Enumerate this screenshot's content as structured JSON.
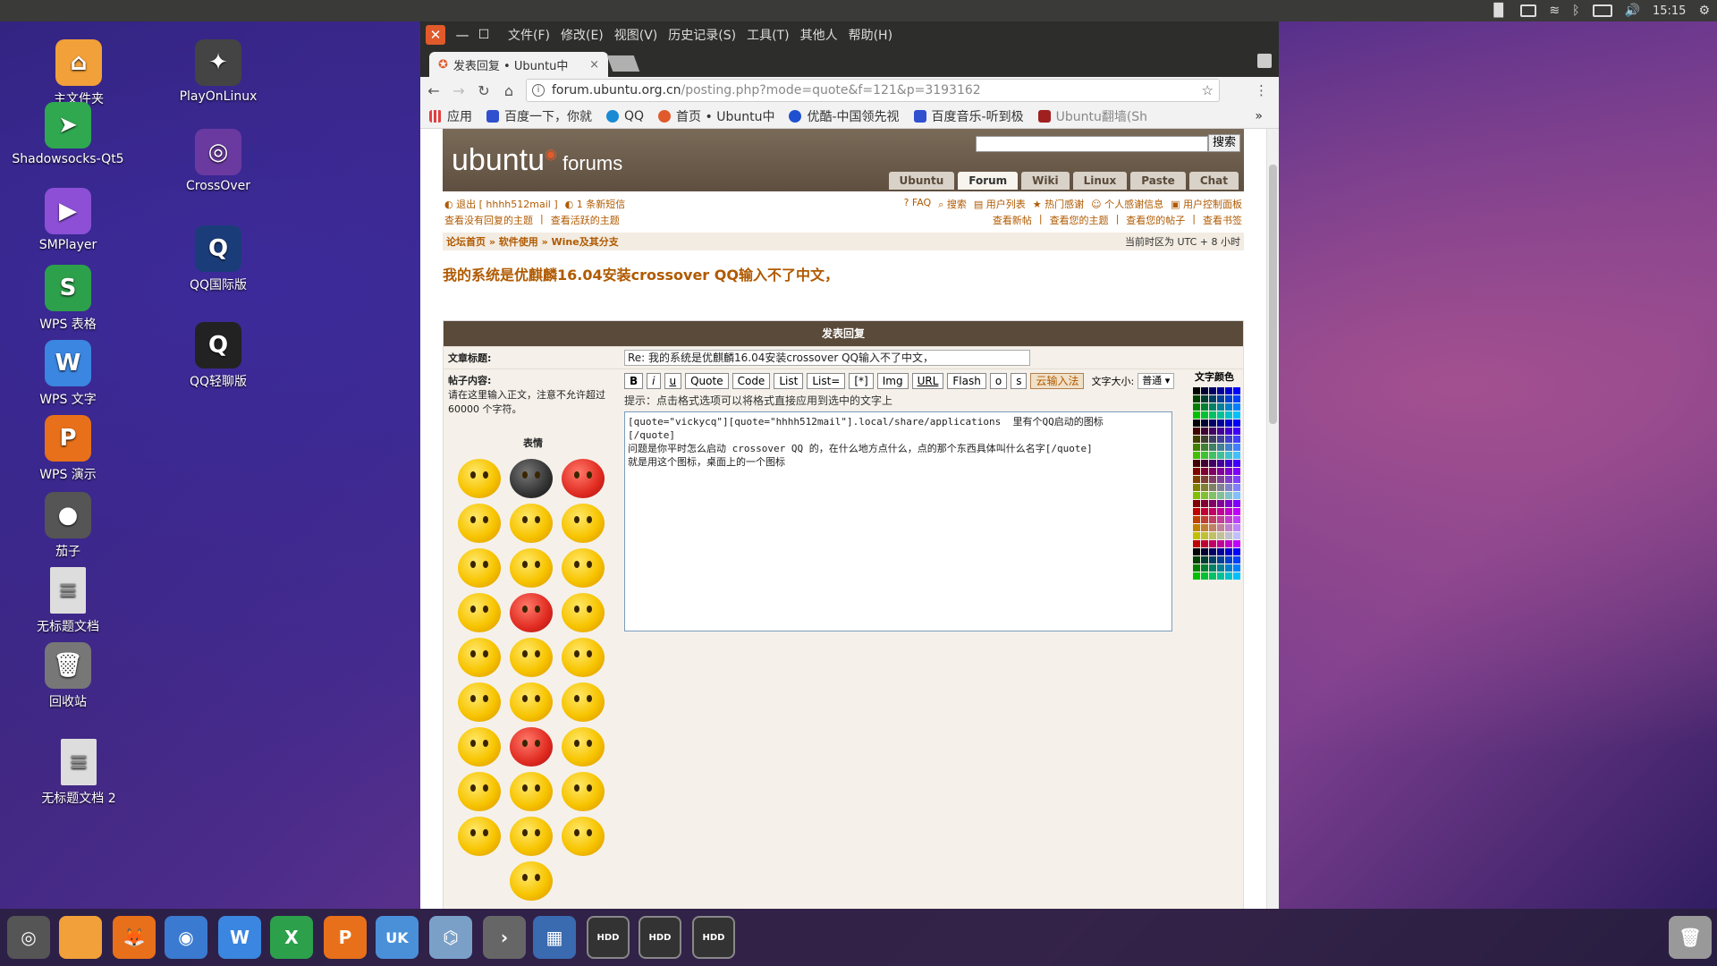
{
  "clock": "15:15",
  "desktop": {
    "icons": [
      {
        "label": "主文件夹",
        "color": "#f2a03a",
        "glyph": "⌂"
      },
      {
        "label": "Shadowsocks-Qt5",
        "color": "#2fa84f",
        "glyph": "➤"
      },
      {
        "label": "SMPlayer",
        "color": "#8c4fd6",
        "glyph": "▶"
      },
      {
        "label": "WPS 表格",
        "color": "#2ca04a",
        "glyph": "S"
      },
      {
        "label": "WPS 文字",
        "color": "#3a86e0",
        "glyph": "W"
      },
      {
        "label": "WPS 演示",
        "color": "#e8701a",
        "glyph": "P"
      },
      {
        "label": "茄子",
        "color": "#555555",
        "glyph": "●"
      },
      {
        "label": "无标题文档",
        "color": "#dddddd",
        "glyph": "≡"
      },
      {
        "label": "回收站",
        "color": "#777777",
        "glyph": "🗑"
      },
      {
        "label": "无标题文档 2",
        "color": "#dddddd",
        "glyph": "≡"
      },
      {
        "label": "PlayOnLinux",
        "color": "#444444",
        "glyph": "✦"
      },
      {
        "label": "CrossOver",
        "color": "#6a3aa0",
        "glyph": "◎"
      },
      {
        "label": "QQ国际版",
        "color": "#1a3d7a",
        "glyph": "Q"
      },
      {
        "label": "QQ轻聊版",
        "color": "#222222",
        "glyph": "Q"
      }
    ]
  },
  "browser": {
    "window_controls": {
      "close": "✕",
      "minimize": "—",
      "maximize": "☐"
    },
    "menu": [
      "文件(F)",
      "修改(E)",
      "视图(V)",
      "历史记录(S)",
      "工具(T)",
      "其他人",
      "帮助(H)"
    ],
    "tab_title": "发表回复 • Ubuntu中",
    "tab_close": "×",
    "url_host": "forum.ubuntu.org.cn",
    "url_path": "/posting.php?mode=quote&f=121&p=3193162",
    "bookmarks": [
      {
        "label": "应用",
        "color": "#e04040"
      },
      {
        "label": "百度一下，你就",
        "color": "#3050d0"
      },
      {
        "label": "QQ",
        "color": "#1a8ad4"
      },
      {
        "label": "首页 • Ubuntu中",
        "color": "#e05a2b"
      },
      {
        "label": "优酷-中国领先视",
        "color": "#2050d0"
      },
      {
        "label": "百度音乐-听到极",
        "color": "#3050d0"
      },
      {
        "label": "Ubuntu翻墙(Sh",
        "color": "#a02020"
      }
    ],
    "bookmarks_more": "»"
  },
  "forum": {
    "logo": "ubuntu",
    "logo_sub": "forums",
    "search_button": "搜索",
    "tabs": [
      "Ubuntu",
      "Forum",
      "Wiki",
      "Linux",
      "Paste",
      "Chat"
    ],
    "active_tab": "Forum",
    "links_left_row1": [
      "退出 [ hhhh512mail ]",
      "1 条新短信"
    ],
    "links_left_row2": [
      "查看没有回复的主题",
      "查看活跃的主题"
    ],
    "links_right_row1": [
      "FAQ",
      "搜索",
      "用户列表",
      "热门感谢",
      "个人感谢信息",
      "用户控制面板"
    ],
    "links_right_row2": [
      "查看新帖",
      "查看您的主题",
      "查看您的帖子",
      "查看书签"
    ],
    "breadcrumb": "论坛首页 » 软件使用 » Wine及其分支",
    "timezone": "当前时区为 UTC + 8 小时",
    "topic_title": "我的系统是优麒麟16.04安装crossover QQ输入不了中文，",
    "post_panel_title": "发表回复",
    "subject_label": "文章标题:",
    "subject_value": "Re: 我的系统是优麒麟16.04安装crossover QQ输入不了中文，",
    "content_label": "帖子内容:",
    "content_note": "请在这里输入正文，注意不允许超过 60000 个字符。",
    "smilies_title": "表情",
    "format_buttons": [
      "B",
      "i",
      "u",
      "Quote",
      "Code",
      "List",
      "List=",
      "[*]",
      "Img",
      "URL",
      "Flash",
      "o",
      "s",
      "云输入法"
    ],
    "fontsize_label": "文字大小:",
    "fontsize_value": "普通",
    "hint": "提示：点击格式选项可以将格式直接应用到选中的文字上",
    "message": "[quote=\"vickycq\"][quote=\"hhhh512mail\"].local/share/applications  里有个QQ启动的图标\n[/quote]\n问题是你平时怎么启动 crossover QQ 的，在什么地方点什么，点的那个东西具体叫什么名字[/quote]\n就是用这个图标，桌面上的一个图标",
    "color_title": "文字颜色",
    "colors": {
      "brand": "#b05a00",
      "header": "#5a4a3a"
    }
  },
  "launcher": [
    {
      "name": "ubuntu-dash",
      "color": "#555555",
      "glyph": "◎"
    },
    {
      "name": "files",
      "color": "#f2a03a",
      "glyph": ""
    },
    {
      "name": "firefox",
      "color": "#e8701a",
      "glyph": "🦊"
    },
    {
      "name": "chromium",
      "color": "#3a7ad0",
      "glyph": "◉"
    },
    {
      "name": "wps-writer",
      "color": "#3a86e0",
      "glyph": "W"
    },
    {
      "name": "wps-spreadsheet",
      "color": "#2ca04a",
      "glyph": "X"
    },
    {
      "name": "wps-presentation",
      "color": "#e8701a",
      "glyph": "P"
    },
    {
      "name": "ubuntu-kylin",
      "color": "#4a90d9",
      "glyph": "UK"
    },
    {
      "name": "scanner",
      "color": "#7aa0c8",
      "glyph": "⌬"
    },
    {
      "name": "terminal-kylin",
      "color": "#666666",
      "glyph": "›"
    },
    {
      "name": "workspace-switcher",
      "color": "#3a6ab0",
      "glyph": "▦"
    },
    {
      "name": "drive-1",
      "color": "#888888",
      "glyph": "HDD"
    },
    {
      "name": "drive-2",
      "color": "#888888",
      "glyph": "HDD"
    },
    {
      "name": "drive-3",
      "color": "#888888",
      "glyph": "HDD"
    },
    {
      "name": "trash",
      "color": "#999999",
      "glyph": "🗑"
    }
  ]
}
